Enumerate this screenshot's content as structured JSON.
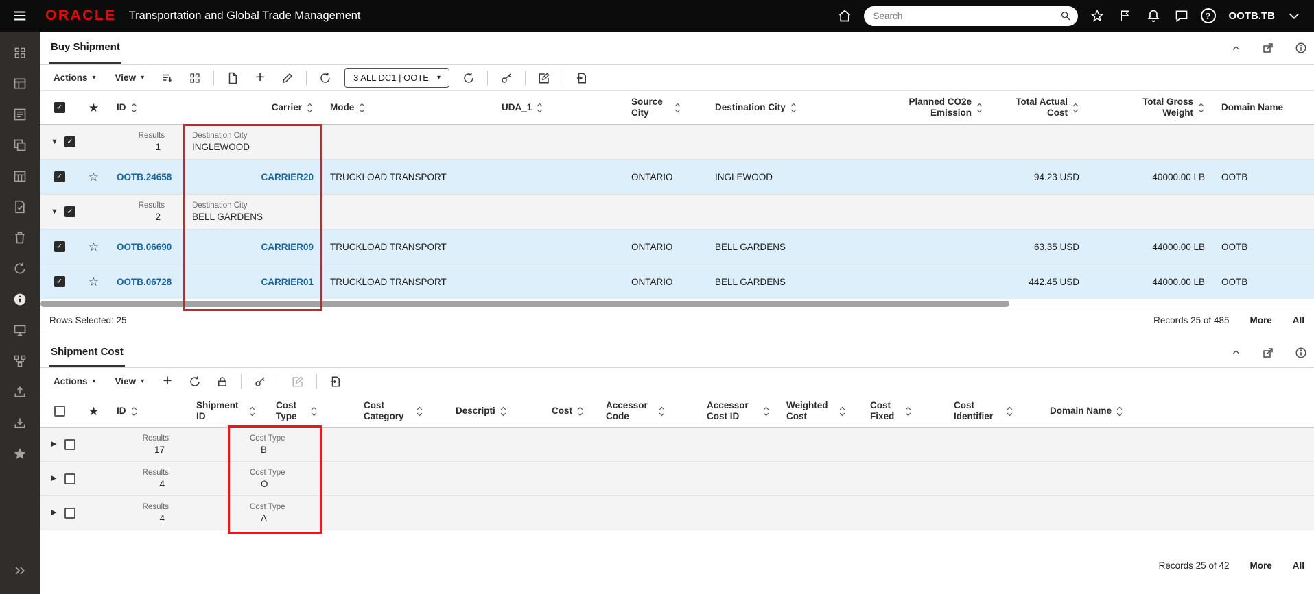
{
  "colors": {
    "topbar_bg": "#0c0c0c",
    "oracle_red": "#f80000",
    "sidebar_bg": "#312d2a",
    "selected_row_bg": "#ddeffa",
    "group_row_bg": "#f4f4f4",
    "link_blue": "#15639f",
    "annotation_red": "#e11b22"
  },
  "icons": {
    "caret_down": "▾",
    "triangle_down": "▼",
    "triangle_right": "▶",
    "star_filled": "★",
    "star_outline": "☆",
    "help": "?",
    "plus": "+"
  },
  "topbar": {
    "brand": "ORACLE",
    "title": "Transportation and Global Trade Management",
    "search_placeholder": "Search",
    "user": "OOTB.TB"
  },
  "sidebar": {
    "icons": [
      "apps-grid",
      "shipments-table",
      "form",
      "copy",
      "calendar-grid",
      "document-check",
      "trash",
      "sync",
      "info",
      "monitor",
      "workflow",
      "upload",
      "download",
      "favorites",
      "expand-panel"
    ]
  },
  "buy_shipment": {
    "title": "Buy Shipment",
    "toolbar": {
      "actions": "Actions",
      "view": "View",
      "saved_search": "3 ALL DC1 | OOTE"
    },
    "columns": {
      "id": "ID",
      "carrier": "Carrier",
      "mode": "Mode",
      "uda1": "UDA_1",
      "source_city": "Source City",
      "destination_city": "Destination City",
      "planned_co2e": "Planned CO2e Emission",
      "total_actual_cost": "Total Actual Cost",
      "total_gross_weight": "Total Gross Weight",
      "domain_name": "Domain Name"
    },
    "groups": [
      {
        "results_label": "Results",
        "count": "1",
        "label": "Destination City",
        "value": "INGLEWOOD"
      },
      {
        "results_label": "Results",
        "count": "2",
        "label": "Destination City",
        "value": "BELL GARDENS"
      }
    ],
    "rows": [
      {
        "id": "OOTB.24658",
        "carrier": "CARRIER20",
        "mode": "TRUCKLOAD TRANSPORT",
        "uda1": "",
        "source_city": "ONTARIO",
        "destination_city": "INGLEWOOD",
        "planned_co2e": "",
        "total_actual_cost": "94.23 USD",
        "total_gross_weight": "40000.00 LB",
        "domain_name": "OOTB"
      },
      {
        "id": "OOTB.06690",
        "carrier": "CARRIER09",
        "mode": "TRUCKLOAD TRANSPORT",
        "uda1": "",
        "source_city": "ONTARIO",
        "destination_city": "BELL GARDENS",
        "planned_co2e": "",
        "total_actual_cost": "63.35 USD",
        "total_gross_weight": "44000.00 LB",
        "domain_name": "OOTB"
      },
      {
        "id": "OOTB.06728",
        "carrier": "CARRIER01",
        "mode": "TRUCKLOAD TRANSPORT",
        "uda1": "",
        "source_city": "ONTARIO",
        "destination_city": "BELL GARDENS",
        "planned_co2e": "",
        "total_actual_cost": "442.45 USD",
        "total_gross_weight": "44000.00 LB",
        "domain_name": "OOTB"
      }
    ],
    "status": {
      "rows_selected": "Rows Selected: 25",
      "records": "Records 25 of 485",
      "more": "More",
      "all": "All"
    }
  },
  "shipment_cost": {
    "title": "Shipment Cost",
    "toolbar": {
      "actions": "Actions",
      "view": "View"
    },
    "columns": {
      "id": "ID",
      "shipment_id": "Shipment ID",
      "cost_type": "Cost Type",
      "cost_category": "Cost Category",
      "description": "Descripti",
      "cost": "Cost",
      "accessorial_code": "Accessor Code",
      "accessorial_cost_id": "Accessor Cost ID",
      "weighted_cost": "Weighted Cost",
      "cost_fixed": "Cost Fixed",
      "cost_identifier": "Cost Identifier",
      "domain_name": "Domain Name"
    },
    "groups": [
      {
        "results_label": "Results",
        "count": "17",
        "label": "Cost Type",
        "value": "B"
      },
      {
        "results_label": "Results",
        "count": "4",
        "label": "Cost Type",
        "value": "O"
      },
      {
        "results_label": "Results",
        "count": "4",
        "label": "Cost Type",
        "value": "A"
      }
    ],
    "status": {
      "records": "Records 25 of 42",
      "more": "More",
      "all": "All"
    }
  }
}
